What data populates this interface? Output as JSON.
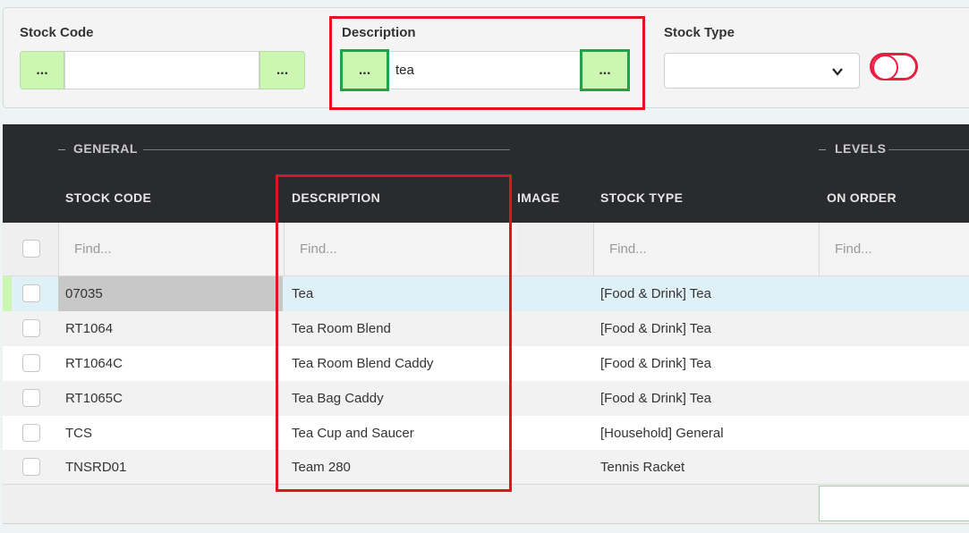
{
  "filters": {
    "stock_code": {
      "label": "Stock Code",
      "value": "",
      "left_btn": "...",
      "right_btn": "..."
    },
    "description": {
      "label": "Description",
      "value": "tea",
      "left_btn": "...",
      "right_btn": "..."
    },
    "stock_type": {
      "label": "Stock Type",
      "value": ""
    }
  },
  "grid": {
    "groups": {
      "general": "GENERAL",
      "levels": "LEVELS"
    },
    "columns": {
      "stock_code": "STOCK CODE",
      "description": "DESCRIPTION",
      "image": "IMAGE",
      "stock_type": "STOCK TYPE",
      "on_order": "ON ORDER"
    },
    "find_placeholder": "Find...",
    "rows": [
      {
        "stock_code": "07035",
        "description": "Tea",
        "stock_type": "[Food & Drink] Tea"
      },
      {
        "stock_code": "RT1064",
        "description": "Tea Room Blend",
        "stock_type": "[Food & Drink] Tea"
      },
      {
        "stock_code": "RT1064C",
        "description": "Tea Room Blend Caddy",
        "stock_type": "[Food & Drink] Tea"
      },
      {
        "stock_code": "RT1065C",
        "description": "Tea Bag Caddy",
        "stock_type": "[Food & Drink] Tea"
      },
      {
        "stock_code": "TCS",
        "description": "Tea Cup and Saucer",
        "stock_type": "[Household] General"
      },
      {
        "stock_code": "TNSRD01",
        "description": "Team 280",
        "stock_type": "Tennis Racket"
      }
    ]
  },
  "colors": {
    "header_bg": "#2a2b2f",
    "lookup_button": "#ccf7b3",
    "highlight_red": "#e3141c",
    "highlight_green": "#1ea34a",
    "selected_row": "#dff0f7",
    "toggle_off": "#e91e42"
  }
}
